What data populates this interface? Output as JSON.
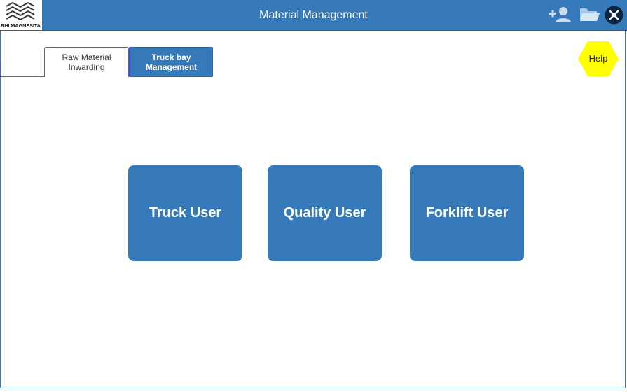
{
  "header": {
    "logo_text": "RHI MAGNESITA",
    "title": "Material Management",
    "icons": [
      "add-user-icon",
      "folder-open-icon",
      "close-icon"
    ]
  },
  "tabs": [
    {
      "label": "Raw Material Inwarding",
      "active": false
    },
    {
      "label": "Truck bay Management",
      "active": true
    }
  ],
  "help": {
    "label": "Help",
    "color": "#ffff00"
  },
  "tiles": [
    {
      "label": "Truck User"
    },
    {
      "label": "Quality User"
    },
    {
      "label": "Forklift User"
    }
  ],
  "colors": {
    "primary": "#3579b8",
    "tab_border": "#4f5fd8",
    "help": "#ffff00"
  }
}
